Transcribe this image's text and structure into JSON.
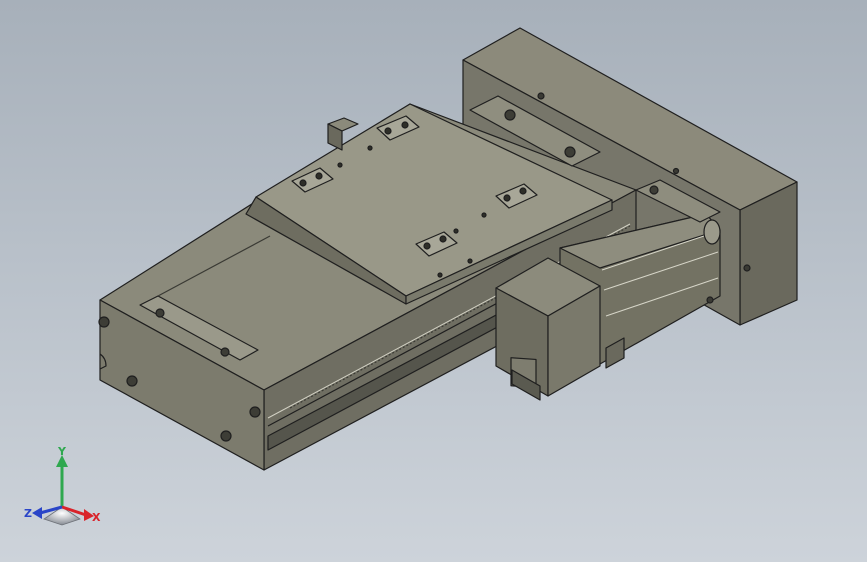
{
  "viewport": {
    "background_top": "#a7b0ba",
    "background_bottom": "#cdd3da",
    "model_color": "#7d7c6e",
    "model_edge_color": "#1f1f1f"
  },
  "triad": {
    "x_label": "X",
    "y_label": "Y",
    "z_label": "Z",
    "x_color": "#d9232a",
    "y_color": "#2fa84f",
    "z_color": "#2a45c8"
  }
}
